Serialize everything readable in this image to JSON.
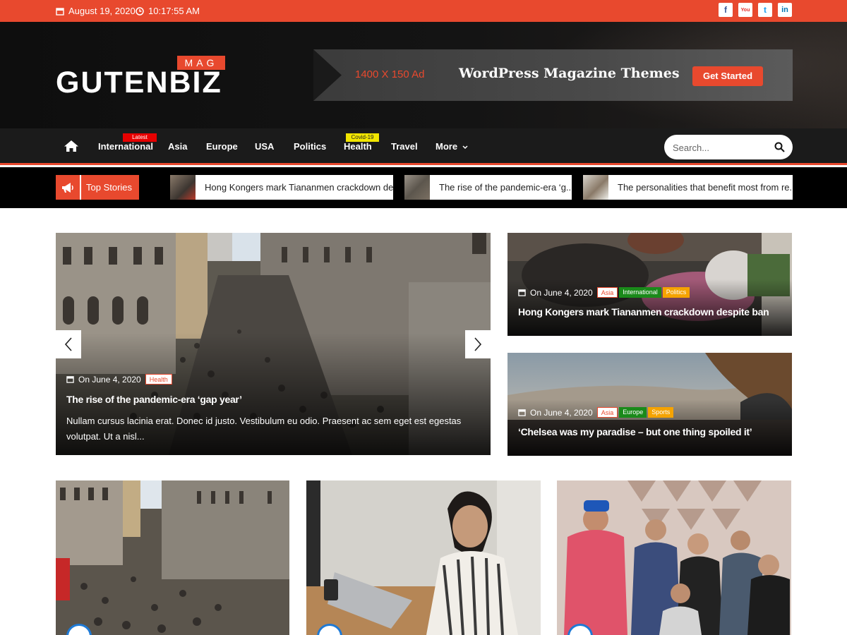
{
  "topbar": {
    "date": "August 19, 2020",
    "time": "10:17:55 AM",
    "social": [
      {
        "icon": "facebook-icon",
        "glyph": "f",
        "color": "#3b5998"
      },
      {
        "icon": "youtube-icon",
        "glyph": "You",
        "color": "#e52d27"
      },
      {
        "icon": "twitter-icon",
        "glyph": "t",
        "color": "#1da1f2"
      },
      {
        "icon": "linkedin-icon",
        "glyph": "in",
        "color": "#0077b5"
      }
    ]
  },
  "header": {
    "logo_main": "GUTENBIZ",
    "logo_sub": "MAG",
    "ad": {
      "size": "1400 X 150 Ad",
      "tagline": "WordPress Magazine Themes",
      "cta": "Get Started"
    }
  },
  "nav": {
    "items": [
      {
        "label": "International",
        "badge": "Latest"
      },
      {
        "label": "Asia"
      },
      {
        "label": "Europe"
      },
      {
        "label": "USA"
      },
      {
        "label": "Politics"
      },
      {
        "label": "Health",
        "badge": "Covid-19"
      },
      {
        "label": "Travel"
      },
      {
        "label": "More"
      }
    ],
    "search_placeholder": "Search..."
  },
  "top_stories": {
    "label": "Top Stories",
    "items": [
      "Hong Kongers mark Tiananmen crackdown de...",
      "The rise of the pandemic-era ‘g...",
      "The personalities that benefit most from re..."
    ]
  },
  "slider": {
    "date": "On June 4, 2020",
    "tags": [
      "Health"
    ],
    "title": "The rise of the pandemic-era ‘gap year’",
    "excerpt": "Nullam cursus lacinia erat. Donec id justo. Vestibulum eu odio. Praesent ac sem eget est egestas volutpat. Ut a nisl..."
  },
  "side_posts": [
    {
      "date": "On June 4, 2020",
      "tags": [
        "Asia",
        "International",
        "Politics"
      ],
      "title": "Hong Kongers mark Tiananmen crackdown despite ban"
    },
    {
      "date": "On June 4, 2020",
      "tags": [
        "Asia",
        "Europe",
        "Sports"
      ],
      "title": "‘Chelsea was my paradise – but one thing spoiled it’"
    }
  ],
  "colors": {
    "accent": "#e8492e",
    "tag_green": "#1a8a1a",
    "tag_orange": "#f5a300"
  }
}
